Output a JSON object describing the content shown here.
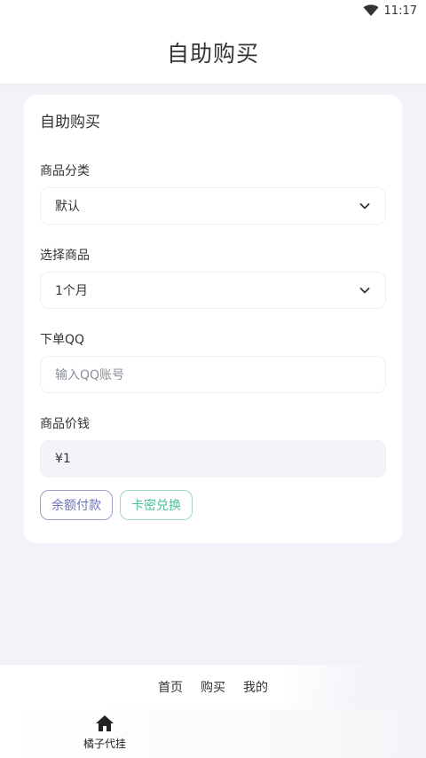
{
  "status_bar": {
    "time": "11:17",
    "wifi_icon": "wifi-icon"
  },
  "header": {
    "title": "自助购买"
  },
  "form": {
    "card_title": "自助购买",
    "category": {
      "label": "商品分类",
      "value": "默认"
    },
    "product": {
      "label": "选择商品",
      "value": "1个月"
    },
    "qq": {
      "label": "下单QQ",
      "placeholder": "输入QQ账号"
    },
    "price": {
      "label": "商品价钱",
      "value": "¥1"
    },
    "buttons": {
      "balance": "余额付款",
      "card_key": "卡密兑换"
    }
  },
  "footer_links": [
    "首页",
    "购买",
    "我的"
  ],
  "tabbar": {
    "home_label": "橘子代挂",
    "home_icon": "home-icon"
  },
  "colors": {
    "balance_button": "#6a74b8",
    "card_key_button": "#4dbf9c",
    "page_bg": "#f2f3f8"
  }
}
